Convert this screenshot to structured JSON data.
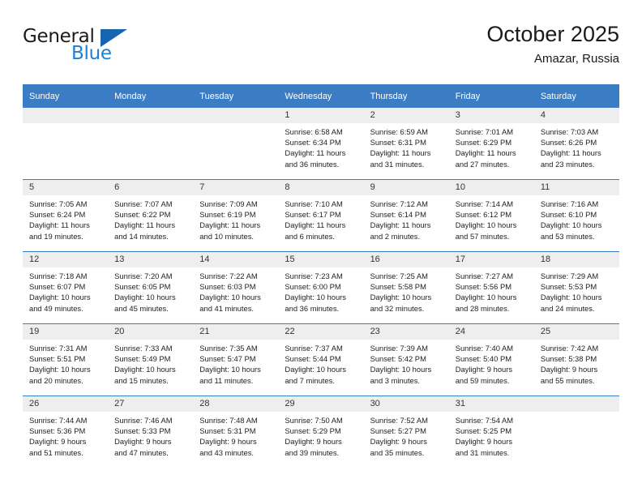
{
  "brand": {
    "word_one": "General",
    "word_two": "Blue",
    "accent_color": "#1c7fd4",
    "triangle_color": "#1565b0",
    "triangle_icon": "triangle-icon"
  },
  "header": {
    "title": "October 2025",
    "subtitle": "Amazar, Russia"
  },
  "theme": {
    "header_blue": "#3b7dc4",
    "daynum_gray": "#eeeeee",
    "text": "#222222"
  },
  "weekday_headers": [
    "Sunday",
    "Monday",
    "Tuesday",
    "Wednesday",
    "Thursday",
    "Friday",
    "Saturday"
  ],
  "weeks": [
    [
      {
        "day": "",
        "sunrise": "",
        "sunset": "",
        "daylight_line1": "",
        "daylight_line2": ""
      },
      {
        "day": "",
        "sunrise": "",
        "sunset": "",
        "daylight_line1": "",
        "daylight_line2": ""
      },
      {
        "day": "",
        "sunrise": "",
        "sunset": "",
        "daylight_line1": "",
        "daylight_line2": ""
      },
      {
        "day": "1",
        "sunrise": "Sunrise: 6:58 AM",
        "sunset": "Sunset: 6:34 PM",
        "daylight_line1": "Daylight: 11 hours",
        "daylight_line2": "and 36 minutes."
      },
      {
        "day": "2",
        "sunrise": "Sunrise: 6:59 AM",
        "sunset": "Sunset: 6:31 PM",
        "daylight_line1": "Daylight: 11 hours",
        "daylight_line2": "and 31 minutes."
      },
      {
        "day": "3",
        "sunrise": "Sunrise: 7:01 AM",
        "sunset": "Sunset: 6:29 PM",
        "daylight_line1": "Daylight: 11 hours",
        "daylight_line2": "and 27 minutes."
      },
      {
        "day": "4",
        "sunrise": "Sunrise: 7:03 AM",
        "sunset": "Sunset: 6:26 PM",
        "daylight_line1": "Daylight: 11 hours",
        "daylight_line2": "and 23 minutes."
      }
    ],
    [
      {
        "day": "5",
        "sunrise": "Sunrise: 7:05 AM",
        "sunset": "Sunset: 6:24 PM",
        "daylight_line1": "Daylight: 11 hours",
        "daylight_line2": "and 19 minutes."
      },
      {
        "day": "6",
        "sunrise": "Sunrise: 7:07 AM",
        "sunset": "Sunset: 6:22 PM",
        "daylight_line1": "Daylight: 11 hours",
        "daylight_line2": "and 14 minutes."
      },
      {
        "day": "7",
        "sunrise": "Sunrise: 7:09 AM",
        "sunset": "Sunset: 6:19 PM",
        "daylight_line1": "Daylight: 11 hours",
        "daylight_line2": "and 10 minutes."
      },
      {
        "day": "8",
        "sunrise": "Sunrise: 7:10 AM",
        "sunset": "Sunset: 6:17 PM",
        "daylight_line1": "Daylight: 11 hours",
        "daylight_line2": "and 6 minutes."
      },
      {
        "day": "9",
        "sunrise": "Sunrise: 7:12 AM",
        "sunset": "Sunset: 6:14 PM",
        "daylight_line1": "Daylight: 11 hours",
        "daylight_line2": "and 2 minutes."
      },
      {
        "day": "10",
        "sunrise": "Sunrise: 7:14 AM",
        "sunset": "Sunset: 6:12 PM",
        "daylight_line1": "Daylight: 10 hours",
        "daylight_line2": "and 57 minutes."
      },
      {
        "day": "11",
        "sunrise": "Sunrise: 7:16 AM",
        "sunset": "Sunset: 6:10 PM",
        "daylight_line1": "Daylight: 10 hours",
        "daylight_line2": "and 53 minutes."
      }
    ],
    [
      {
        "day": "12",
        "sunrise": "Sunrise: 7:18 AM",
        "sunset": "Sunset: 6:07 PM",
        "daylight_line1": "Daylight: 10 hours",
        "daylight_line2": "and 49 minutes."
      },
      {
        "day": "13",
        "sunrise": "Sunrise: 7:20 AM",
        "sunset": "Sunset: 6:05 PM",
        "daylight_line1": "Daylight: 10 hours",
        "daylight_line2": "and 45 minutes."
      },
      {
        "day": "14",
        "sunrise": "Sunrise: 7:22 AM",
        "sunset": "Sunset: 6:03 PM",
        "daylight_line1": "Daylight: 10 hours",
        "daylight_line2": "and 41 minutes."
      },
      {
        "day": "15",
        "sunrise": "Sunrise: 7:23 AM",
        "sunset": "Sunset: 6:00 PM",
        "daylight_line1": "Daylight: 10 hours",
        "daylight_line2": "and 36 minutes."
      },
      {
        "day": "16",
        "sunrise": "Sunrise: 7:25 AM",
        "sunset": "Sunset: 5:58 PM",
        "daylight_line1": "Daylight: 10 hours",
        "daylight_line2": "and 32 minutes."
      },
      {
        "day": "17",
        "sunrise": "Sunrise: 7:27 AM",
        "sunset": "Sunset: 5:56 PM",
        "daylight_line1": "Daylight: 10 hours",
        "daylight_line2": "and 28 minutes."
      },
      {
        "day": "18",
        "sunrise": "Sunrise: 7:29 AM",
        "sunset": "Sunset: 5:53 PM",
        "daylight_line1": "Daylight: 10 hours",
        "daylight_line2": "and 24 minutes."
      }
    ],
    [
      {
        "day": "19",
        "sunrise": "Sunrise: 7:31 AM",
        "sunset": "Sunset: 5:51 PM",
        "daylight_line1": "Daylight: 10 hours",
        "daylight_line2": "and 20 minutes."
      },
      {
        "day": "20",
        "sunrise": "Sunrise: 7:33 AM",
        "sunset": "Sunset: 5:49 PM",
        "daylight_line1": "Daylight: 10 hours",
        "daylight_line2": "and 15 minutes."
      },
      {
        "day": "21",
        "sunrise": "Sunrise: 7:35 AM",
        "sunset": "Sunset: 5:47 PM",
        "daylight_line1": "Daylight: 10 hours",
        "daylight_line2": "and 11 minutes."
      },
      {
        "day": "22",
        "sunrise": "Sunrise: 7:37 AM",
        "sunset": "Sunset: 5:44 PM",
        "daylight_line1": "Daylight: 10 hours",
        "daylight_line2": "and 7 minutes."
      },
      {
        "day": "23",
        "sunrise": "Sunrise: 7:39 AM",
        "sunset": "Sunset: 5:42 PM",
        "daylight_line1": "Daylight: 10 hours",
        "daylight_line2": "and 3 minutes."
      },
      {
        "day": "24",
        "sunrise": "Sunrise: 7:40 AM",
        "sunset": "Sunset: 5:40 PM",
        "daylight_line1": "Daylight: 9 hours",
        "daylight_line2": "and 59 minutes."
      },
      {
        "day": "25",
        "sunrise": "Sunrise: 7:42 AM",
        "sunset": "Sunset: 5:38 PM",
        "daylight_line1": "Daylight: 9 hours",
        "daylight_line2": "and 55 minutes."
      }
    ],
    [
      {
        "day": "26",
        "sunrise": "Sunrise: 7:44 AM",
        "sunset": "Sunset: 5:36 PM",
        "daylight_line1": "Daylight: 9 hours",
        "daylight_line2": "and 51 minutes."
      },
      {
        "day": "27",
        "sunrise": "Sunrise: 7:46 AM",
        "sunset": "Sunset: 5:33 PM",
        "daylight_line1": "Daylight: 9 hours",
        "daylight_line2": "and 47 minutes."
      },
      {
        "day": "28",
        "sunrise": "Sunrise: 7:48 AM",
        "sunset": "Sunset: 5:31 PM",
        "daylight_line1": "Daylight: 9 hours",
        "daylight_line2": "and 43 minutes."
      },
      {
        "day": "29",
        "sunrise": "Sunrise: 7:50 AM",
        "sunset": "Sunset: 5:29 PM",
        "daylight_line1": "Daylight: 9 hours",
        "daylight_line2": "and 39 minutes."
      },
      {
        "day": "30",
        "sunrise": "Sunrise: 7:52 AM",
        "sunset": "Sunset: 5:27 PM",
        "daylight_line1": "Daylight: 9 hours",
        "daylight_line2": "and 35 minutes."
      },
      {
        "day": "31",
        "sunrise": "Sunrise: 7:54 AM",
        "sunset": "Sunset: 5:25 PM",
        "daylight_line1": "Daylight: 9 hours",
        "daylight_line2": "and 31 minutes."
      },
      {
        "day": "",
        "sunrise": "",
        "sunset": "",
        "daylight_line1": "",
        "daylight_line2": ""
      }
    ]
  ]
}
